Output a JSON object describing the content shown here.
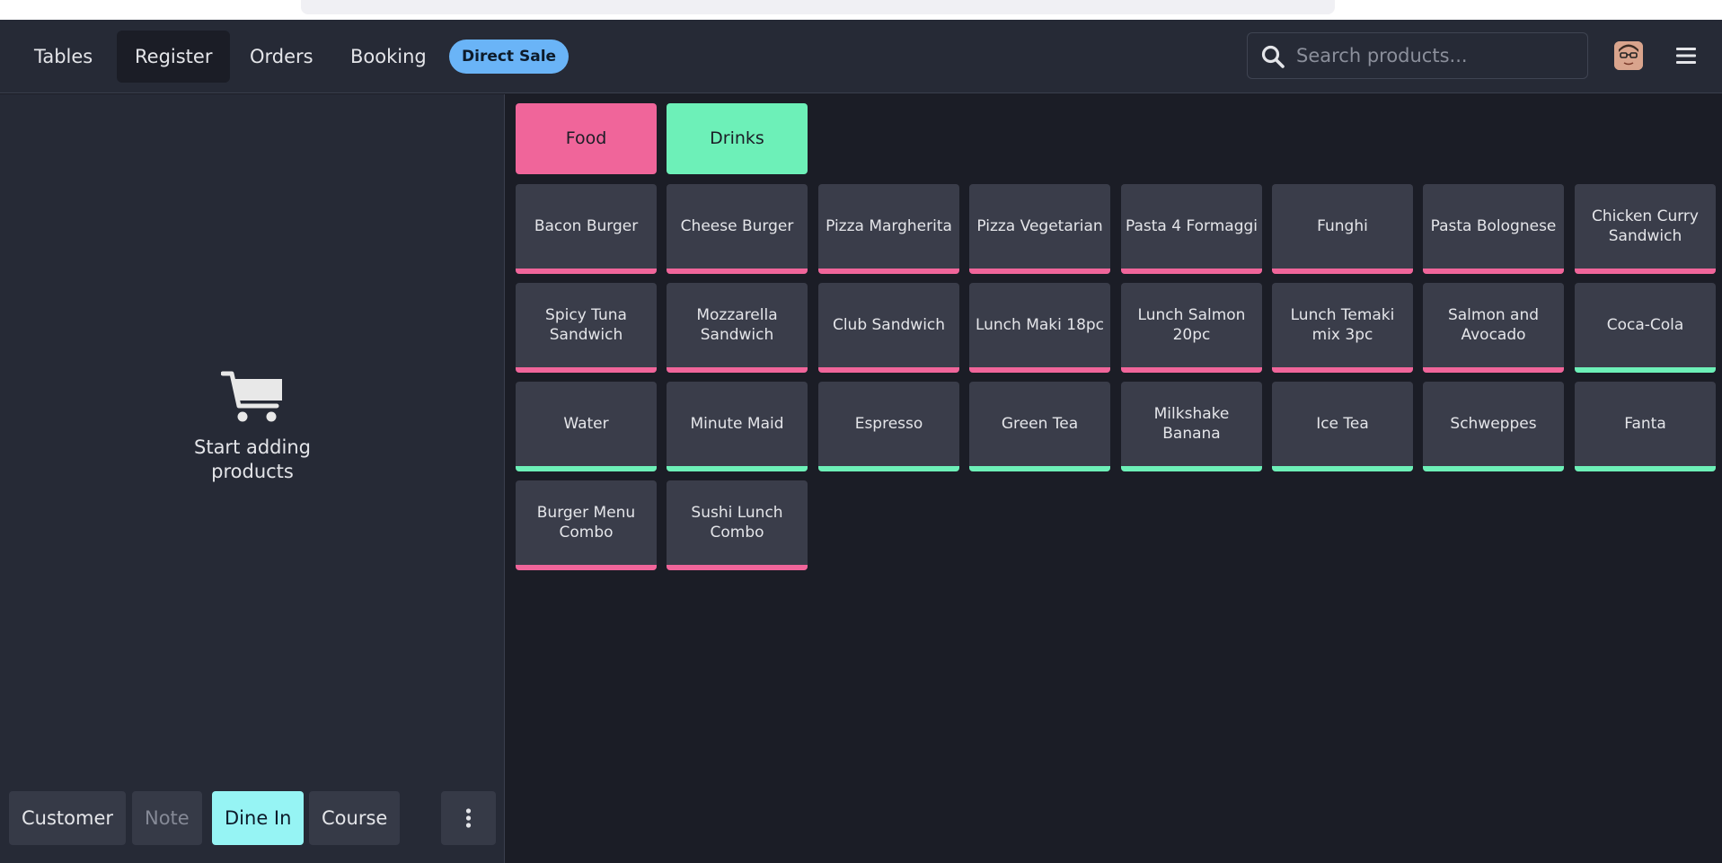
{
  "nav": {
    "tabs": [
      {
        "label": "Tables"
      },
      {
        "label": "Register"
      },
      {
        "label": "Orders"
      },
      {
        "label": "Booking"
      }
    ],
    "direct_sale": "Direct Sale",
    "search_placeholder": "Search products...",
    "active_tab": "Register"
  },
  "cart": {
    "empty_text": "Start adding products"
  },
  "actions": {
    "customer": "Customer",
    "note": "Note",
    "dine_in": "Dine In",
    "course": "Course"
  },
  "categories": [
    {
      "label": "Food",
      "color": "#f0659a"
    },
    {
      "label": "Drinks",
      "color": "#6df0b8"
    }
  ],
  "products": [
    {
      "label": "Bacon Burger",
      "category": "Food"
    },
    {
      "label": "Cheese Burger",
      "category": "Food"
    },
    {
      "label": "Pizza Margherita",
      "category": "Food"
    },
    {
      "label": "Pizza Vegetarian",
      "category": "Food"
    },
    {
      "label": "Pasta 4 Formaggi",
      "category": "Food"
    },
    {
      "label": "Funghi",
      "category": "Food"
    },
    {
      "label": "Pasta Bolognese",
      "category": "Food"
    },
    {
      "label": "Chicken Curry Sandwich",
      "category": "Food"
    },
    {
      "label": "Spicy Tuna Sandwich",
      "category": "Food"
    },
    {
      "label": "Mozzarella Sandwich",
      "category": "Food"
    },
    {
      "label": "Club Sandwich",
      "category": "Food"
    },
    {
      "label": "Lunch Maki 18pc",
      "category": "Food"
    },
    {
      "label": "Lunch Salmon 20pc",
      "category": "Food"
    },
    {
      "label": "Lunch Temaki mix 3pc",
      "category": "Food"
    },
    {
      "label": "Salmon and Avocado",
      "category": "Food"
    },
    {
      "label": "Coca-Cola",
      "category": "Drinks"
    },
    {
      "label": "Water",
      "category": "Drinks"
    },
    {
      "label": "Minute Maid",
      "category": "Drinks"
    },
    {
      "label": "Espresso",
      "category": "Drinks"
    },
    {
      "label": "Green Tea",
      "category": "Drinks"
    },
    {
      "label": "Milkshake Banana",
      "category": "Drinks"
    },
    {
      "label": "Ice Tea",
      "category": "Drinks"
    },
    {
      "label": "Schweppes",
      "category": "Drinks"
    },
    {
      "label": "Fanta",
      "category": "Drinks"
    },
    {
      "label": "Burger Menu Combo",
      "category": "Food"
    },
    {
      "label": "Sushi Lunch Combo",
      "category": "Food"
    }
  ],
  "icons": {
    "search": "search-icon",
    "cart": "cart-icon",
    "menu": "hamburger-menu-icon",
    "more": "vertical-dots-icon"
  }
}
